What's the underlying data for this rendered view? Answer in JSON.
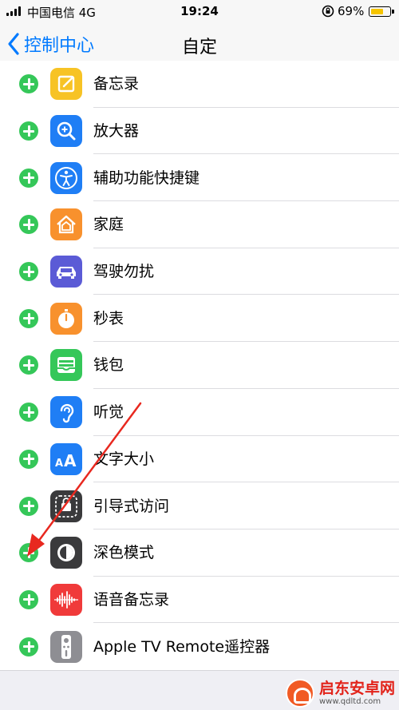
{
  "status_bar": {
    "carrier": "中国电信 4G",
    "time": "19:24",
    "battery_percent": "69%",
    "battery_level": 0.69
  },
  "nav": {
    "back_label": "控制中心",
    "title": "自定"
  },
  "controls": [
    {
      "label": "备忘录",
      "icon": "notes-icon",
      "color": "#f7c325"
    },
    {
      "label": "放大器",
      "icon": "magnifier-icon",
      "color": "#1f7ef5"
    },
    {
      "label": "辅助功能快捷键",
      "icon": "accessibility-icon",
      "color": "#1f7ef5"
    },
    {
      "label": "家庭",
      "icon": "home-icon",
      "color": "#f8912d"
    },
    {
      "label": "驾驶勿扰",
      "icon": "car-icon",
      "color": "#5b5bd6"
    },
    {
      "label": "秒表",
      "icon": "stopwatch-icon",
      "color": "#f8912d"
    },
    {
      "label": "钱包",
      "icon": "wallet-icon",
      "color": "#35c759"
    },
    {
      "label": "听觉",
      "icon": "ear-icon",
      "color": "#1f7ef5"
    },
    {
      "label": "文字大小",
      "icon": "text-size-icon",
      "color": "#1f7ef5"
    },
    {
      "label": "引导式访问",
      "icon": "guided-access-icon",
      "color": "#3a3a3c"
    },
    {
      "label": "深色模式",
      "icon": "dark-mode-icon",
      "color": "#3a3a3c"
    },
    {
      "label": "语音备忘录",
      "icon": "voice-memo-icon",
      "color": "#f03a3a"
    },
    {
      "label": "Apple TV Remote遥控器",
      "icon": "apple-tv-remote-icon",
      "color": "#8e8e93"
    }
  ],
  "watermark": {
    "name": "启东安卓网",
    "url": "www.qdltd.com"
  }
}
